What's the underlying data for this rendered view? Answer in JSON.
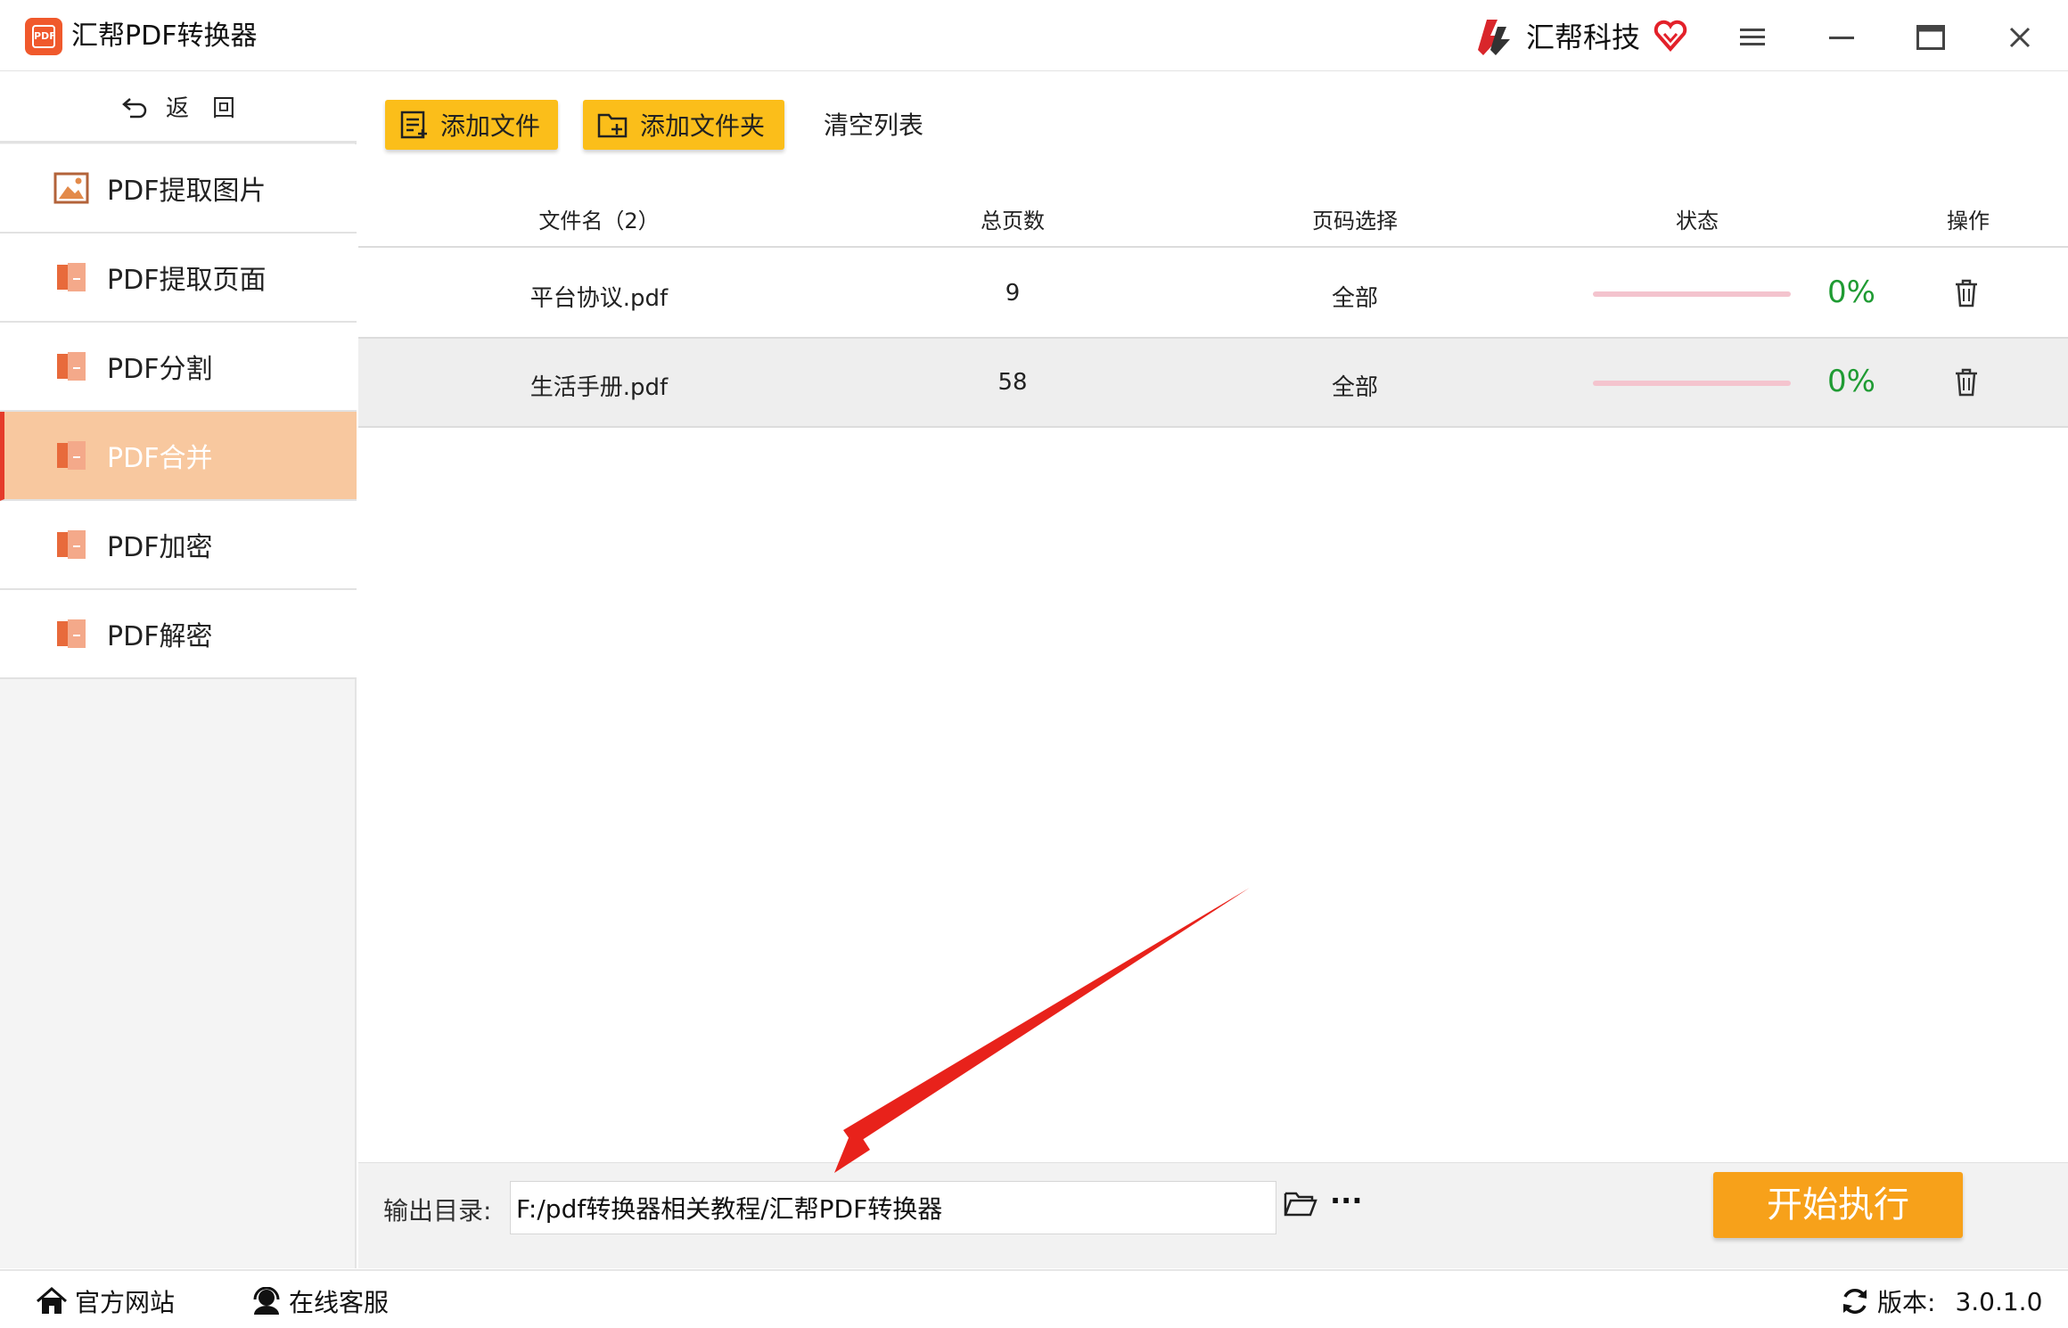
{
  "window": {
    "title": "汇帮PDF转换器",
    "logo_text": "PDF",
    "brand": "汇帮科技"
  },
  "sidebar": {
    "back_label": "返　回",
    "items": [
      {
        "label": "PDF提取图片",
        "icon": "image-icon",
        "active": false
      },
      {
        "label": "PDF提取页面",
        "icon": "pdf-file-icon",
        "active": false
      },
      {
        "label": "PDF分割",
        "icon": "pdf-file-icon",
        "active": false
      },
      {
        "label": "PDF合并",
        "icon": "pdf-file-icon",
        "active": true
      },
      {
        "label": "PDF加密",
        "icon": "pdf-file-icon",
        "active": false
      },
      {
        "label": "PDF解密",
        "icon": "pdf-file-icon",
        "active": false
      }
    ]
  },
  "toolbar": {
    "add_file": "添加文件",
    "add_folder": "添加文件夹",
    "clear_list": "清空列表"
  },
  "table": {
    "headers": {
      "filename": "文件名（2）",
      "pages": "总页数",
      "page_select": "页码选择",
      "status": "状态",
      "action": "操作"
    },
    "rows": [
      {
        "filename": "平台协议.pdf",
        "pages": "9",
        "page_select": "全部",
        "progress_text": "0%",
        "progress": 0
      },
      {
        "filename": "生活手册.pdf",
        "pages": "58",
        "page_select": "全部",
        "progress_text": "0%",
        "progress": 0
      }
    ]
  },
  "output": {
    "label": "输出目录:",
    "path": "F:/pdf转换器相关教程/汇帮PDF转换器",
    "more": "···",
    "start": "开始执行"
  },
  "statusbar": {
    "website": "官方网站",
    "support": "在线客服",
    "version_label": "版本:",
    "version": "3.0.1.0"
  },
  "colors": {
    "accent_yellow": "#fbbe1a",
    "start_orange": "#f7a11a",
    "active_nav": "#f8c89f",
    "active_border": "#e53b2a",
    "progress_green": "#1f9b33",
    "annotation_red": "#e8221b"
  }
}
